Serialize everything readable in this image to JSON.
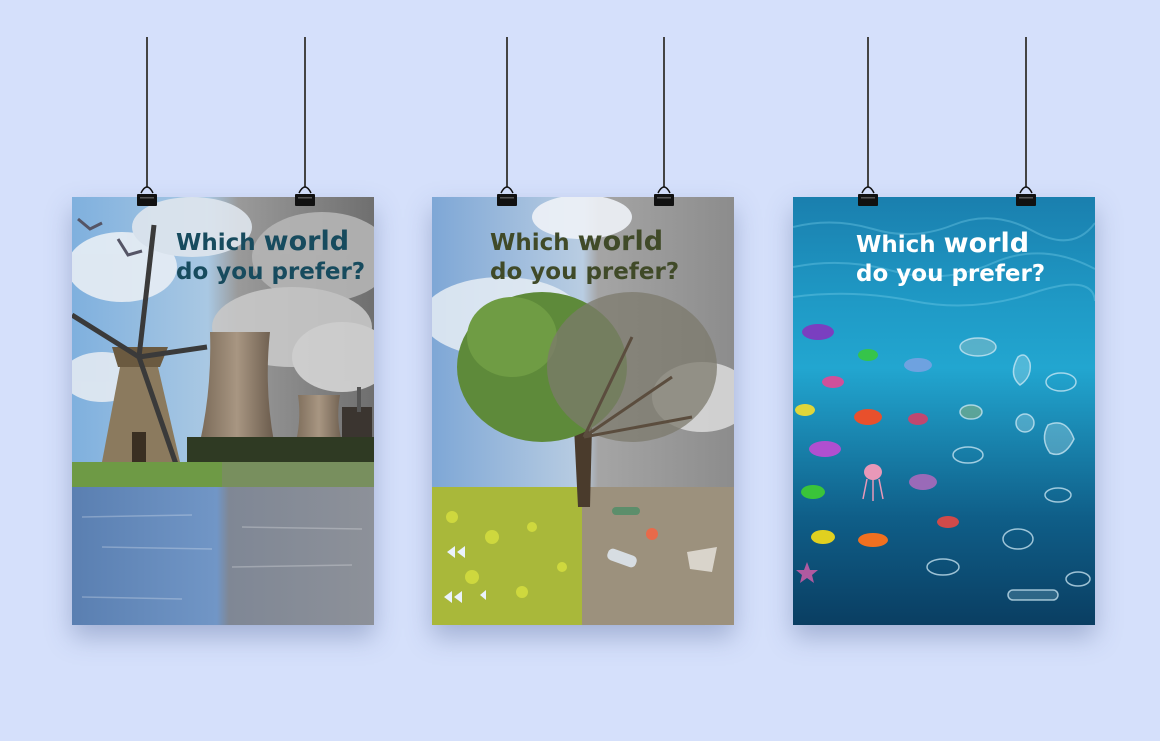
{
  "posters": [
    {
      "headline": {
        "line1_pre": "Which ",
        "line1_emph": "world",
        "line2": "do you prefer?"
      }
    },
    {
      "headline": {
        "line1_pre": "Which ",
        "line1_emph": "world",
        "line2": "do you prefer?"
      }
    },
    {
      "headline": {
        "line1_pre": "Which ",
        "line1_emph": "world",
        "line2": "do you prefer?"
      }
    }
  ],
  "colors": {
    "background": "#d5e0fb",
    "headline_1": "#174b5e",
    "headline_2": "#404a28",
    "headline_3": "#ffffff"
  },
  "icons": [
    "binder-clip-icon",
    "windmill-icon",
    "cooling-tower-icon",
    "tree-icon",
    "fish-icon",
    "jellyfish-icon",
    "starfish-icon",
    "plastic-bottle-icon",
    "seagull-icon",
    "butterfly-icon"
  ]
}
